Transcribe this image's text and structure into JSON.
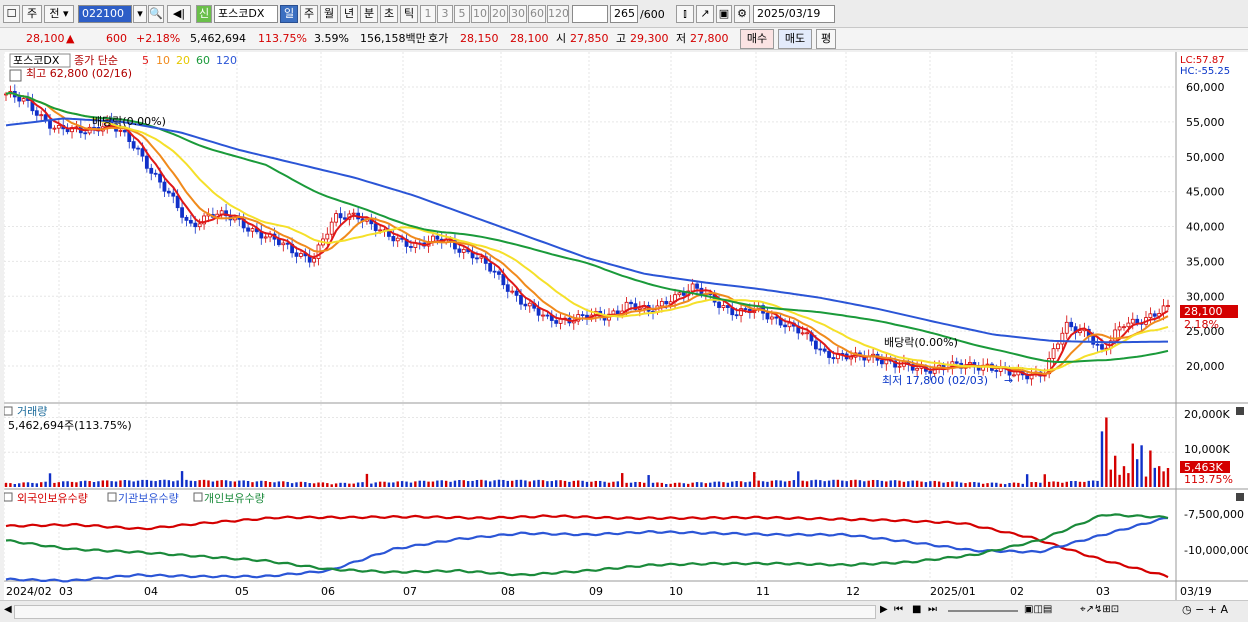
{
  "toolbar": {
    "period_type": "주",
    "compare": "전",
    "code": "022100",
    "badge": "신",
    "name": "포스코DX",
    "intervals": [
      "일",
      "주",
      "월",
      "년",
      "분",
      "초",
      "틱"
    ],
    "active_interval": "일",
    "minute_options": [
      "1",
      "3",
      "5",
      "10",
      "20",
      "30",
      "60",
      "120"
    ],
    "count": "265",
    "count_max": "/600",
    "date": "2025/03/19"
  },
  "quote": {
    "price": "28,100",
    "change": "600",
    "change_pct": "+2.18%",
    "volume": "5,462,694",
    "volume_ratio": "113.75%",
    "turnover": "3.59%",
    "amount": "156,158백만",
    "hoga_label": "호가",
    "ask": "28,150",
    "bid": "28,100",
    "open_label": "시",
    "open": "27,850",
    "high_label": "고",
    "high": "29,300",
    "low_label": "저",
    "low": "27,800",
    "buy_button": "매수",
    "sell_button": "매도",
    "eval_button": "평"
  },
  "price_panel": {
    "name": "포스코DX",
    "indicator_label": "종가 단순",
    "ma_periods": [
      "5",
      "10",
      "20",
      "60",
      "120"
    ],
    "ma_colors": [
      "#e01818",
      "#f08a1c",
      "#f5e02a",
      "#1a9a3a",
      "#2b55d6"
    ],
    "high_note": "최고 62,800 (02/16)",
    "low_note": "최저 17,800 (02/03)",
    "dividend_1": "배당락(0.00%)",
    "dividend_2": "배당락(0.00%)",
    "lc": "LC:57.87",
    "hc": "HC:-55.25",
    "y_ticks": [
      "60,000",
      "55,000",
      "50,000",
      "45,000",
      "40,000",
      "35,000",
      "30,000",
      "25,000",
      "20,000"
    ],
    "last_price": "28,100",
    "last_pct": "2.18%"
  },
  "volume_panel": {
    "title": "거래량",
    "value": "5,462,694주(113.75%)",
    "y_ticks": [
      "20,000K",
      "10,000K"
    ],
    "last": "5,463K",
    "last_pct": "113.75%"
  },
  "holding_panel": {
    "series": [
      {
        "name": "외국인보유수량",
        "color": "#d40000"
      },
      {
        "name": "기관보유수량",
        "color": "#2b55d6"
      },
      {
        "name": "개인보유수량",
        "color": "#1a8a3a"
      }
    ],
    "y_ticks": [
      "-7,500,000",
      "-10,000,000"
    ]
  },
  "x_axis": {
    "labels": [
      "2024/02",
      "03",
      "04",
      "05",
      "06",
      "07",
      "08",
      "09",
      "10",
      "11",
      "12",
      "2025/01",
      "02",
      "03",
      "03/19"
    ]
  },
  "chart_data": {
    "type": "line",
    "ma_20_approx": [
      57000,
      56000,
      54000,
      50000,
      45000,
      41000,
      39500,
      38000,
      37000,
      33000,
      30000,
      29000,
      29500,
      28500,
      26000,
      21500,
      20000,
      19500,
      20000,
      26000,
      27000
    ],
    "ma_120_approx": [
      54500,
      55500,
      55000,
      53500,
      51000,
      49000,
      47000,
      44500,
      41500,
      38500,
      35500,
      33200,
      32000,
      31000,
      29800,
      28200,
      26300,
      24500,
      23600,
      23400,
      23500
    ],
    "ylim": [
      17000,
      63000
    ]
  }
}
